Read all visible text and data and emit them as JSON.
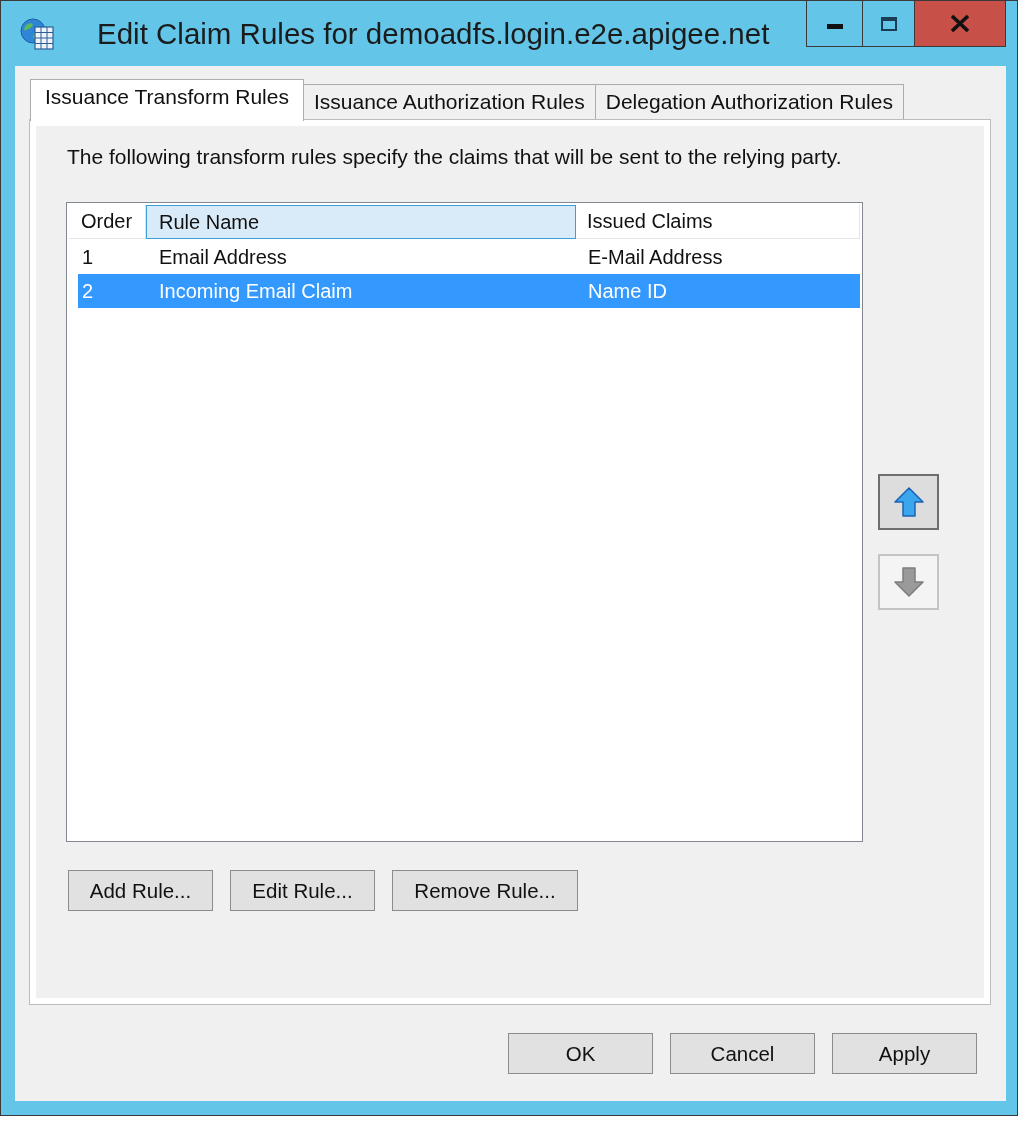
{
  "window": {
    "title": "Edit Claim Rules for demoadfs.login.e2e.apigee.net"
  },
  "tabs": [
    {
      "label": "Issuance Transform Rules",
      "selected": true
    },
    {
      "label": "Issuance Authorization Rules",
      "selected": false
    },
    {
      "label": "Delegation Authorization Rules",
      "selected": false
    }
  ],
  "description": "The following transform rules specify the claims that will be sent to the relying party.",
  "rules_list": {
    "columns": [
      {
        "label": "Order",
        "highlighted": false
      },
      {
        "label": "Rule Name",
        "highlighted": true
      },
      {
        "label": "Issued Claims",
        "highlighted": false
      }
    ],
    "rows": [
      {
        "cells": [
          "1",
          "Email Address",
          "E-Mail Address"
        ],
        "selected": false
      },
      {
        "cells": [
          "2",
          "Incoming Email Claim",
          "Name ID"
        ],
        "selected": true
      }
    ]
  },
  "move_buttons": [
    {
      "kind": "up",
      "disabled": false
    },
    {
      "kind": "down",
      "disabled": true
    }
  ],
  "rule_buttons": [
    "Add Rule...",
    "Edit Rule...",
    "Remove Rule..."
  ],
  "dialog_buttons": [
    "OK",
    "Cancel",
    "Apply"
  ]
}
